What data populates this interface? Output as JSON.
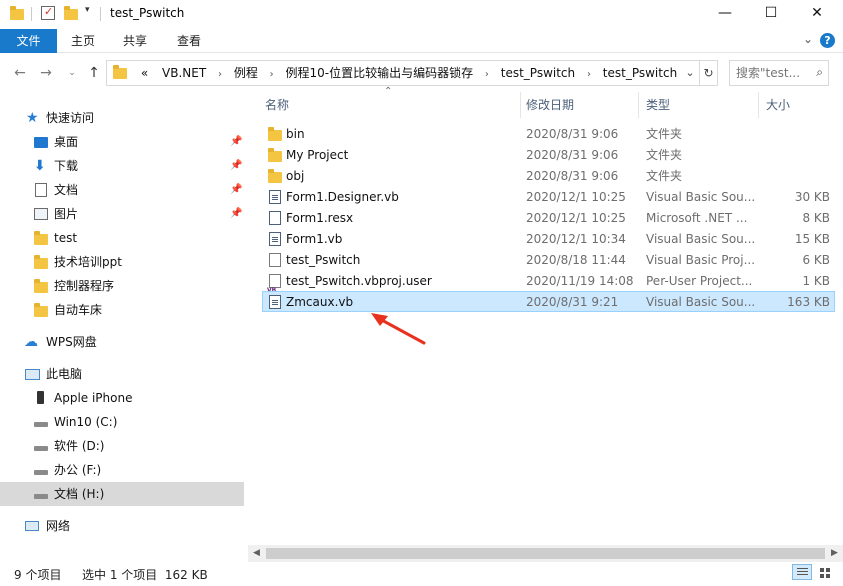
{
  "window": {
    "title": "test_Pswitch",
    "controls": {
      "minimize": "—",
      "maximize": "☐",
      "close": "✕"
    }
  },
  "ribbon": {
    "tabs": [
      {
        "label": "文件"
      },
      {
        "label": "主页"
      },
      {
        "label": "共享"
      },
      {
        "label": "查看"
      }
    ],
    "help": "?"
  },
  "addressbar": {
    "overflow": "«",
    "crumbs": [
      "VB.NET",
      "例程",
      "例程10-位置比较输出与编码器锁存",
      "test_Pswitch",
      "test_Pswitch"
    ],
    "search_placeholder": "搜索\"test..."
  },
  "navpane": {
    "quick_access": "快速访问",
    "pinned": [
      {
        "label": "桌面",
        "icon": "desktop-icon"
      },
      {
        "label": "下载",
        "icon": "download-icon"
      },
      {
        "label": "文档",
        "icon": "document-icon"
      },
      {
        "label": "图片",
        "icon": "picture-icon"
      }
    ],
    "recent": [
      {
        "label": "test"
      },
      {
        "label": "技术培训ppt"
      },
      {
        "label": "控制器程序"
      },
      {
        "label": "自动车床"
      }
    ],
    "wps": "WPS网盘",
    "this_pc": "此电脑",
    "devices": [
      {
        "label": "Apple iPhone",
        "icon": "phone-icon"
      },
      {
        "label": "Win10 (C:)",
        "icon": "drive-icon"
      },
      {
        "label": "软件 (D:)",
        "icon": "drive-icon"
      },
      {
        "label": "办公 (F:)",
        "icon": "drive-icon"
      },
      {
        "label": "文档 (H:)",
        "icon": "drive-icon"
      }
    ],
    "network": "网络"
  },
  "columns": {
    "name": "名称",
    "date": "修改日期",
    "type": "类型",
    "size": "大小"
  },
  "files": [
    {
      "name": "bin",
      "date": "2020/8/31 9:06",
      "type": "文件夹",
      "size": "",
      "icon": "folder-icon"
    },
    {
      "name": "My Project",
      "date": "2020/8/31 9:06",
      "type": "文件夹",
      "size": "",
      "icon": "folder-icon"
    },
    {
      "name": "obj",
      "date": "2020/8/31 9:06",
      "type": "文件夹",
      "size": "",
      "icon": "folder-icon"
    },
    {
      "name": "Form1.Designer.vb",
      "date": "2020/12/1 10:25",
      "type": "Visual Basic Sou...",
      "size": "30 KB",
      "icon": "vb-file-icon"
    },
    {
      "name": "Form1.resx",
      "date": "2020/12/1 10:25",
      "type": "Microsoft .NET ...",
      "size": "8 KB",
      "icon": "resx-file-icon"
    },
    {
      "name": "Form1.vb",
      "date": "2020/12/1 10:34",
      "type": "Visual Basic Sou...",
      "size": "15 KB",
      "icon": "vb-file-icon"
    },
    {
      "name": "test_Pswitch",
      "date": "2020/8/18 11:44",
      "type": "Visual Basic Proj...",
      "size": "6 KB",
      "icon": "blank-file-icon"
    },
    {
      "name": "test_Pswitch.vbproj.user",
      "date": "2020/11/19 14:08",
      "type": "Per-User Project...",
      "size": "1 KB",
      "icon": "vbproj-user-icon"
    },
    {
      "name": "Zmcaux.vb",
      "date": "2020/8/31 9:21",
      "type": "Visual Basic Sou...",
      "size": "163 KB",
      "icon": "vb-file-icon",
      "selected": true
    }
  ],
  "status": {
    "count": "9 个项目",
    "selection": "选中 1 个项目  162 KB"
  },
  "colors": {
    "accent": "#1979ca",
    "selection_bg": "#cce8ff",
    "selection_border": "#99d1ff",
    "annotation_arrow": "#e8321e"
  }
}
